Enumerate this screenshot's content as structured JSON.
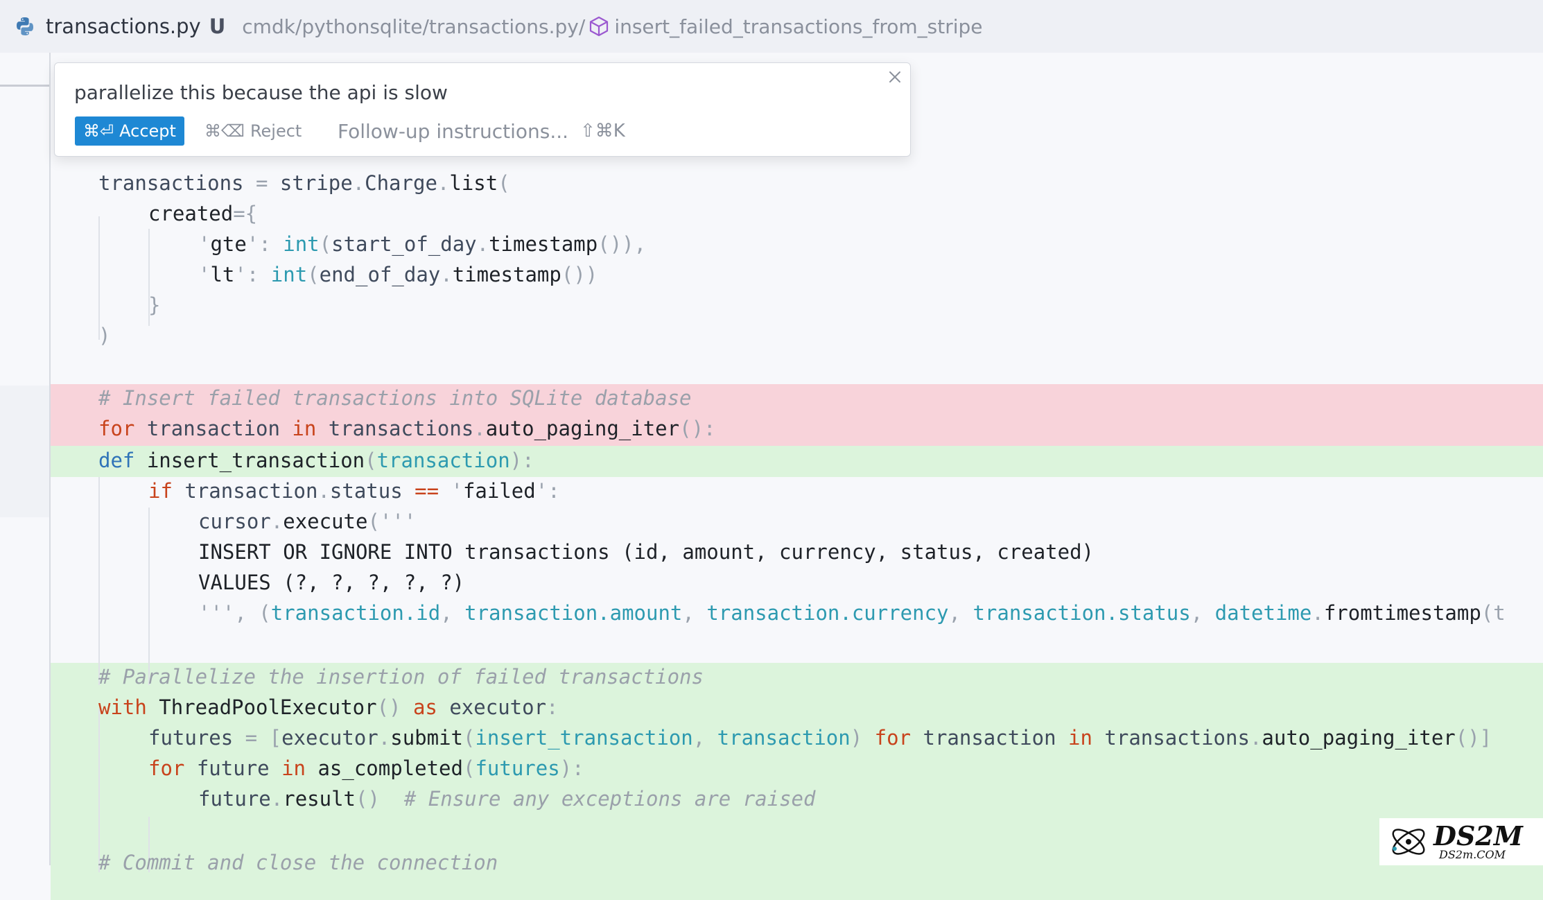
{
  "header": {
    "file_name": "transactions.py",
    "modified_marker": "U",
    "breadcrumb_path": "cmdk/pythonsqlite/transactions.py/",
    "breadcrumb_symbol": "insert_failed_transactions_from_stripe",
    "file_icon": "python-icon",
    "symbol_icon": "cube-icon"
  },
  "popup": {
    "prompt": "parallelize this because the api is slow",
    "accept_shortcut": "⌘⏎",
    "accept_label": "Accept",
    "reject_shortcut": "⌘⌫",
    "reject_label": "Reject",
    "followup_placeholder": "Follow-up instructions...",
    "followup_shortcut": "⇧⌘K",
    "accent_color": "#1e88d4"
  },
  "diff_colors": {
    "removed": "#f8d3da",
    "added": "#dcf4dc"
  },
  "code": {
    "l1": {
      "a": "transactions",
      "b": " = ",
      "c": "stripe",
      "d": ".",
      "e": "Charge",
      "f": ".",
      "g": "list",
      "h": "("
    },
    "l2": {
      "a": "created",
      "b": "={"
    },
    "l3": {
      "a": "'",
      "b": "gte",
      "c": "'",
      "d": ": ",
      "e": "int",
      "f": "(",
      "g": "start_of_day",
      "h": ".",
      "i": "timestamp",
      "j": "()),"
    },
    "l4": {
      "a": "'",
      "b": "lt",
      "c": "'",
      "d": ": ",
      "e": "int",
      "f": "(",
      "g": "end_of_day",
      "h": ".",
      "i": "timestamp",
      "j": "())"
    },
    "l5": {
      "a": "}"
    },
    "l6": {
      "a": ")"
    },
    "r1": {
      "a": "# Insert failed transactions into SQLite database"
    },
    "r2": {
      "a": "for",
      "b": " transaction ",
      "c": "in",
      "d": " transactions",
      "e": ".",
      "f": "auto_paging_iter",
      "g": "():"
    },
    "g1": {
      "a": "def",
      "b": " insert_transaction",
      "c": "(",
      "d": "transaction",
      "e": "):"
    },
    "g2": {
      "a": "if",
      "b": " transaction",
      "c": ".",
      "d": "status ",
      "e": "==",
      "f": " '",
      "g": "failed",
      "h": "':"
    },
    "g3": {
      "a": "cursor",
      "b": ".",
      "c": "execute",
      "d": "('''"
    },
    "g4": {
      "a": "INSERT OR IGNORE INTO transactions (id, amount, currency, status, created)"
    },
    "g5": {
      "a": "VALUES (?, ?, ?, ?, ?)"
    },
    "g6": {
      "a": "''', (",
      "b": "transaction.id",
      "c": ", ",
      "d": "transaction.amount",
      "e": ", ",
      "f": "transaction.currency",
      "g": ", ",
      "h": "transaction.status",
      "i": ", ",
      "j": "datetime",
      "k": ".",
      "l": "fromtimestamp",
      "m": "(t"
    },
    "h1": {
      "a": "# Parallelize the insertion of failed transactions"
    },
    "h2": {
      "a": "with",
      "b": " ThreadPoolExecutor",
      "c": "()",
      "d": " as",
      "e": " executor",
      "f": ":"
    },
    "h3": {
      "a": "futures",
      "b": " = ",
      "c": "[",
      "d": "executor",
      "e": ".",
      "f": "submit",
      "g": "(",
      "h": "insert_transaction",
      "i": ", ",
      "j": "transaction",
      "k": ")",
      "l": " for",
      "m": " transaction ",
      "n": "in",
      "o": " transactions",
      "p": ".",
      "q": "auto_paging_iter",
      "r": "()]"
    },
    "h4": {
      "a": "for",
      "b": " future ",
      "c": "in",
      "d": " as_completed",
      "e": "(",
      "f": "futures",
      "g": "):"
    },
    "h5": {
      "a": "future",
      "b": ".",
      "c": "result",
      "d": "()",
      "e": "  # Ensure any exceptions are raised"
    },
    "t1": {
      "a": "# Commit and close the connection"
    }
  },
  "watermark": {
    "brand": "DS2M",
    "site": "DS2m.COM"
  }
}
